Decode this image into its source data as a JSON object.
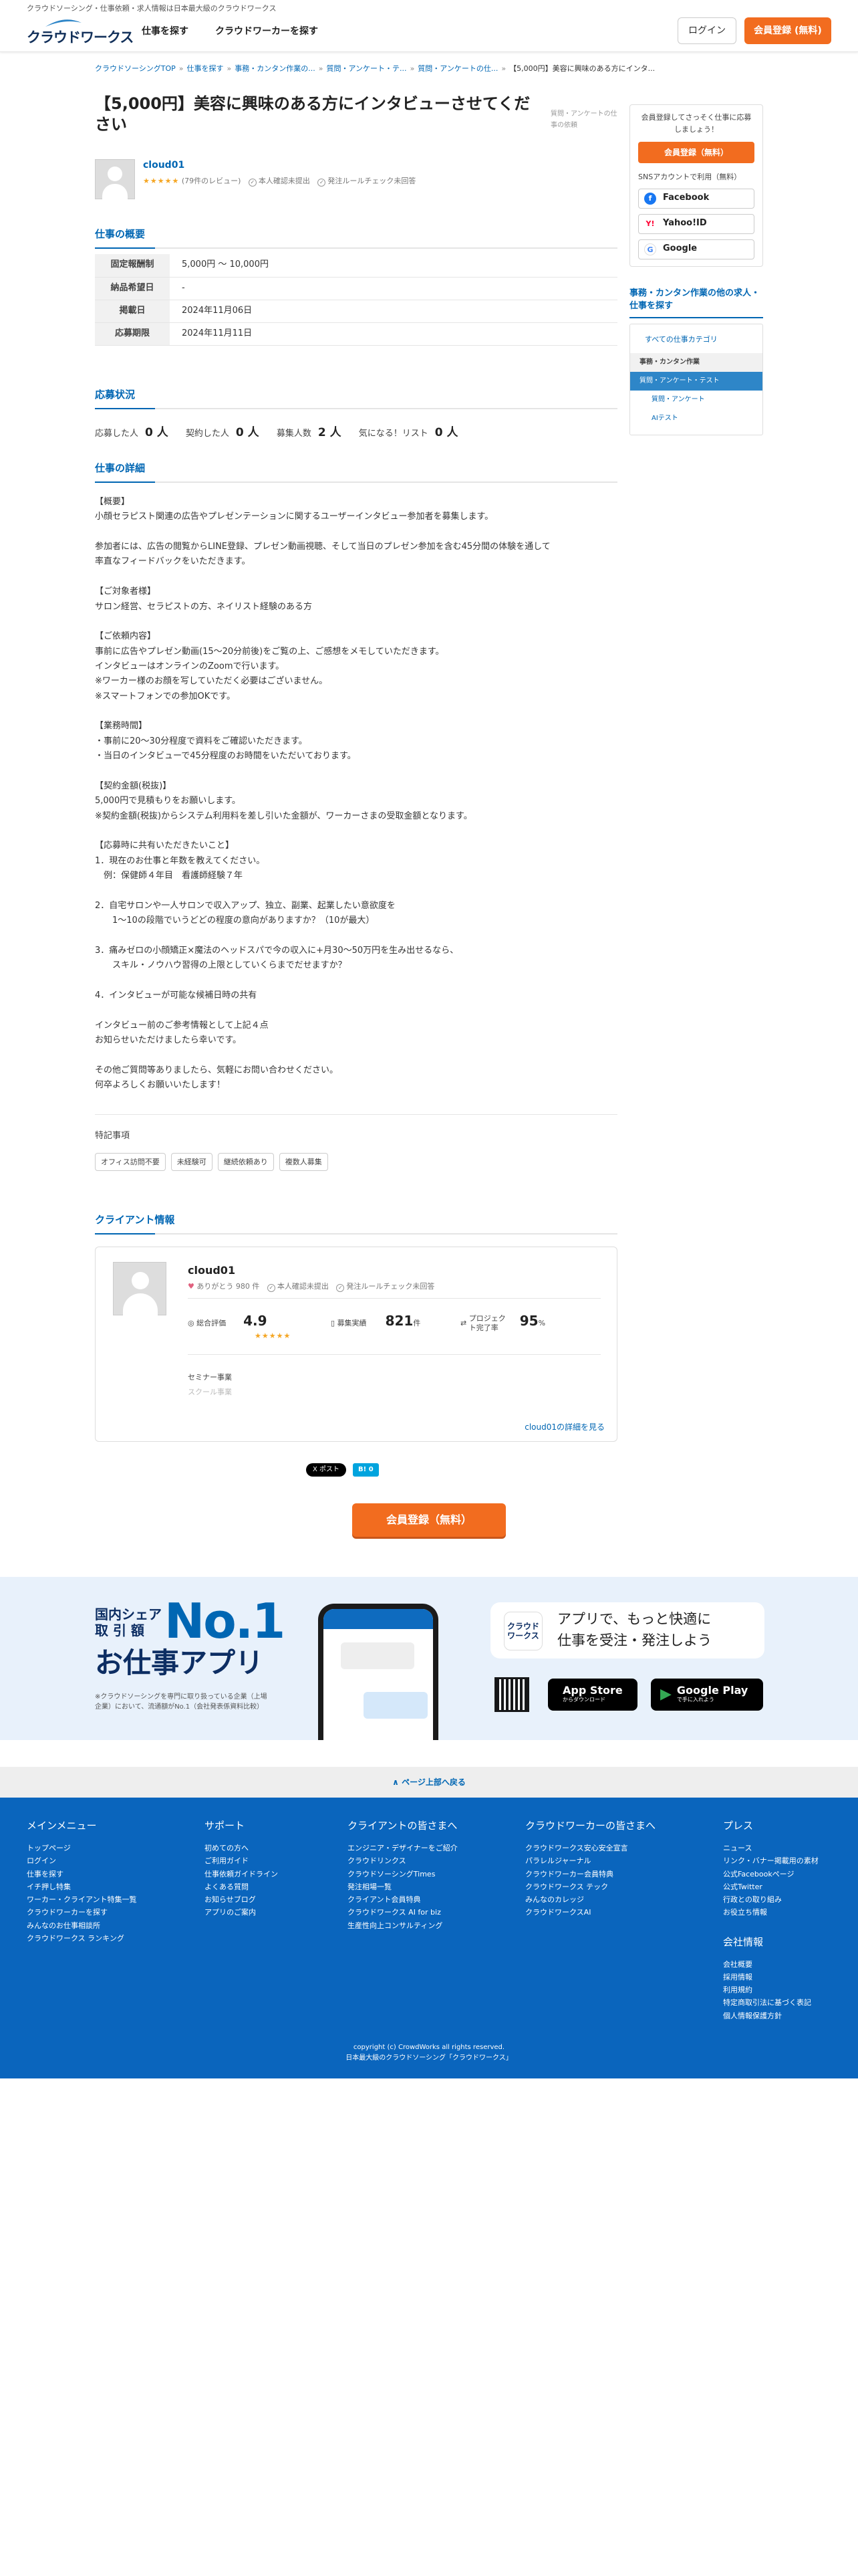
{
  "header": {
    "tagline": "クラウドソーシング・仕事依頼・求人情報は日本最大級のクラウドワークス",
    "logo": "クラウドワークス",
    "nav": [
      "仕事を探す",
      "クラウドワーカーを探す"
    ],
    "login": "ログイン",
    "signup": "会員登録 (無料)"
  },
  "breadcrumb": [
    "クラウドソーシングTOP",
    "仕事を探す",
    "事務・カンタン作業の...",
    "質問・アンケート・テ...",
    "質問・アンケートの仕...",
    "【5,000円】美容に興味のある方にインタ..."
  ],
  "job": {
    "title": "【5,000円】美容に興味のある方にインタビューさせてください",
    "category": "質問・アンケートの仕事の依頼",
    "client_name": "cloud01",
    "client_stars": "★★★★★",
    "client_reviews": "(79件のレビュー)",
    "identity": "本人確認未提出",
    "rule_check": "発注ルールチェック未回答"
  },
  "overview": {
    "heading": "仕事の概要",
    "rows": [
      {
        "k": "固定報酬制",
        "v": "5,000円 〜 10,000円"
      },
      {
        "k": "納品希望日",
        "v": "-"
      },
      {
        "k": "掲載日",
        "v": "2024年11月06日"
      },
      {
        "k": "応募期限",
        "v": "2024年11月11日"
      }
    ]
  },
  "status": {
    "heading": "応募状況",
    "applied_label": "応募した人",
    "applied": "0 人",
    "contracted_label": "契約した人",
    "contracted": "0 人",
    "recruit_label": "募集人数",
    "recruit": "2 人",
    "fav_label": "気になる！リスト",
    "fav": "0 人"
  },
  "detail": {
    "heading": "仕事の詳細",
    "body": "【概要】\n小顔セラピスト関連の広告やプレゼンテーションに関するユーザーインタビュー参加者を募集します。\n\n参加者には、広告の閲覧からLINE登録、プレゼン動画視聴、そして当日のプレゼン参加を含む45分間の体験を通して\n率直なフィードバックをいただきます。\n\n【ご対象者様】\nサロン経営、セラピストの方、ネイリスト経験のある方\n\n【ご依頼内容】\n事前に広告やプレゼン動画(15〜20分前後)をご覧の上、ご感想をメモしていただきます。\nインタビューはオンラインのZoomで行います。\n※ワーカー様のお顔を写していただく必要はございません。\n※スマートフォンでの参加OKです。\n\n【業務時間】\n・事前に20〜30分程度で資料をご確認いただきます。\n・当日のインタビューで45分程度のお時間をいただいております。\n\n【契約金額(税抜)】\n5,000円で見積もりをお願いします。\n※契約金額(税抜)からシステム利用料を差し引いた金額が、ワーカーさまの受取金額となります。\n\n【応募時に共有いただきたいこと】\n1．現在のお仕事と年数を教えてください。\n　例：保健師４年目　看護師経験７年\n\n2．自宅サロンや一人サロンで収入アップ、独立、副業、起業したい意欲度を\n　　1〜10の段階でいうどどの程度の意向がありますか？（10が最大）\n\n3．痛みゼロの小顔矯正×魔法のヘッドスパで今の収入に+月30〜50万円を生み出せるなら、\n　　スキル・ノウハウ習得の上限としていくらまでだせますか？\n\n4．インタビューが可能な候補日時の共有\n\nインタビュー前のご参考情報として上記４点\nお知らせいただけましたら幸いです。\n\nその他ご質問等ありましたら、気軽にお問い合わせください。\n何卒よろしくお願いいたします！"
  },
  "specials": {
    "label": "特記事項",
    "tags": [
      "オフィス訪問不要",
      "未経験可",
      "継続依頼あり",
      "複数人募集"
    ]
  },
  "client_info": {
    "heading": "クライアント情報",
    "name": "cloud01",
    "thanks": "ありがとう 980 件",
    "identity": "本人確認未提出",
    "rule": "発注ルールチェック未回答",
    "rating_label": "総合評価",
    "rating": "4.9",
    "stars": "★★★★★",
    "orders_label": "募集実績",
    "orders": "821",
    "orders_unit": "件",
    "completion_label": "プロジェクト完了率",
    "completion": "95",
    "completion_unit": "%",
    "field1": "セミナー事業",
    "field2": "スクール事業",
    "more": "cloud01の詳細を見る"
  },
  "share": {
    "x": "X ポスト",
    "hatena": "B! 0"
  },
  "cta": "会員登録（無料）",
  "sidebar": {
    "promo": "会員登録してさっそく仕事に応募しましょう！",
    "promo_btn": "会員登録（無料）",
    "sns": "SNSアカウントで利用（無料）",
    "fb": "Facebook",
    "yahoo": "Yahoo!ID",
    "google": "Google",
    "cat_heading": "事務・カンタン作業の他の求人・仕事を探す",
    "all": "すべての仕事カテゴリ",
    "c1": "事務・カンタン作業",
    "c2": "質問・アンケート・テスト",
    "c3": "質問・アンケート",
    "c4": "AIテスト"
  },
  "app": {
    "l1a": "国内シェア",
    "l1b": "取 引 額",
    "no1": "No.1",
    "l2": "お仕事アプリ",
    "note": "※クラウドソーシングを専門に取り扱っている企業（上場企業）において、流通額がNo.1（会社発表係資料比較）",
    "icon": "クラウド\nワークス",
    "speech1": "アプリで、もっと快適に",
    "speech2": "仕事を受注・発注しよう",
    "appstore_s": "からダウンロード",
    "appstore": "App Store",
    "gp_s": "で手に入れよう",
    "gp": "Google Play"
  },
  "backtop": "∧ ページ上部へ戻る",
  "footer": {
    "c1h": "メインメニュー",
    "c1": [
      "トップページ",
      "ログイン",
      "仕事を探す",
      "イチ押し特集",
      "ワーカー・クライアント特集一覧",
      "クラウドワーカーを探す",
      "みんなのお仕事相談所",
      "クラウドワークス ランキング"
    ],
    "c2h": "サポート",
    "c2": [
      "初めての方へ",
      "ご利用ガイド",
      "仕事依頼ガイドライン",
      "よくある質問",
      "お知らせブログ",
      "アプリのご案内"
    ],
    "c3h": "クライアントの皆さまへ",
    "c3": [
      "エンジニア・デザイナーをご紹介",
      "クラウドリンクス",
      "クラウドソーシングTimes",
      "発注相場一覧",
      "クライアント会員特典",
      "クラウドワークス AI for biz",
      "生産性向上コンサルティング"
    ],
    "c4h": "クラウドワーカーの皆さまへ",
    "c4": [
      "クラウドワークス安心安全宣言",
      "パラレルジャーナル",
      "クラウドワーカー会員特典",
      "クラウドワークス テック",
      "みんなのカレッジ",
      "クラウドワークスAI"
    ],
    "c5h": "プレス",
    "c5": [
      "ニュース",
      "リンク・バナー掲載用の素材",
      "公式Facebookページ",
      "公式Twitter",
      "行政との取り組み",
      "お役立ち情報"
    ],
    "c6h": "会社情報",
    "c6": [
      "会社概要",
      "採用情報",
      "利用規約",
      "特定商取引法に基づく表記",
      "個人情報保護方針"
    ],
    "copy1": "copyright (c) CrowdWorks all rights reserved.",
    "copy2": "日本最大級のクラウドソーシング「クラウドワークス」"
  }
}
